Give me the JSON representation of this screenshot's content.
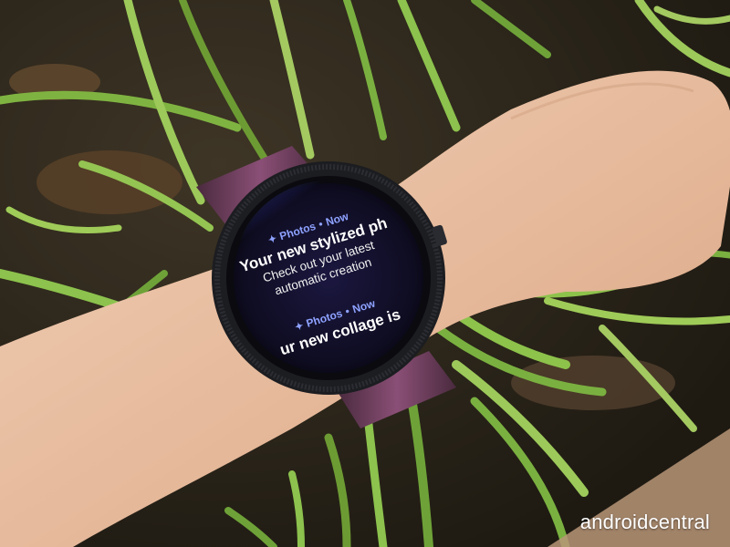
{
  "notifications": [
    {
      "app_icon": "photos-icon",
      "app": "Photos",
      "separator": "•",
      "time": "Now",
      "title": "Your new stylized ph",
      "body_line1": "Check out your latest",
      "body_line2": "automatic creation"
    },
    {
      "app_icon": "photos-icon",
      "app": "Photos",
      "separator": "•",
      "time": "Now",
      "title": "ur new collage is",
      "body_line1": "",
      "body_line2": ""
    }
  ],
  "watermark": "androidcentral",
  "colors": {
    "accent": "#8ea2ff",
    "screen": "#120f24",
    "bezel": "#1a1b1f",
    "skin": "#e9c4a8",
    "grass": "#6fa23a",
    "strap": "#6a3b5a"
  }
}
